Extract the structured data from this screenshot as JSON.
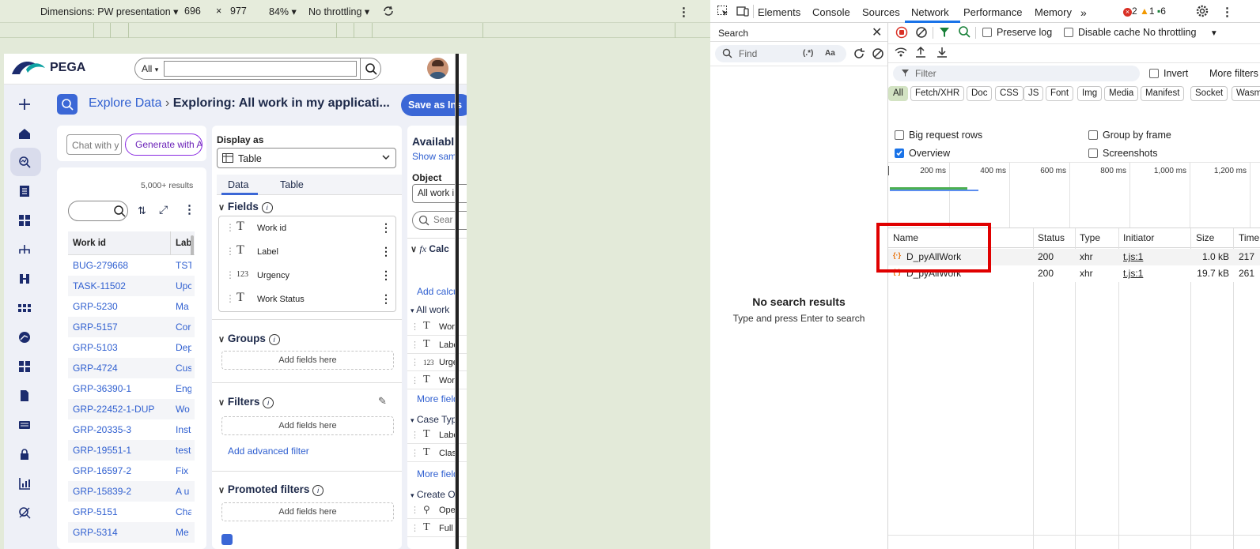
{
  "device_toolbar": {
    "dimensions_label": "Dimensions: PW presentation",
    "width": "696",
    "times": "×",
    "height": "977",
    "zoom": "84%",
    "throttling": "No throttling"
  },
  "pega": {
    "logo": "PEGA",
    "search_scope": "All",
    "search_placeholder": "",
    "breadcrumb_parent": "Explore Data",
    "breadcrumb_sep": "›",
    "breadcrumb_current": "Exploring: All work in my applicati...",
    "save_button": "Save as Ins",
    "chat_placeholder": "Chat with y",
    "generate_button": "Generate with AI",
    "results_count": "5,000+ results",
    "columns": [
      "Work id",
      "Lab"
    ],
    "rows": [
      {
        "id": "BUG-279668",
        "label": "TST"
      },
      {
        "id": "TASK-11502",
        "label": "Upc"
      },
      {
        "id": "GRP-5230",
        "label": "Ma"
      },
      {
        "id": "GRP-5157",
        "label": "Cor"
      },
      {
        "id": "GRP-5103",
        "label": "Dep"
      },
      {
        "id": "GRP-4724",
        "label": "Cus"
      },
      {
        "id": "GRP-36390-1",
        "label": "Eng"
      },
      {
        "id": "GRP-22452-1-DUP",
        "label": "Wo"
      },
      {
        "id": "GRP-20335-3",
        "label": "Inst"
      },
      {
        "id": "GRP-19551-1",
        "label": "test"
      },
      {
        "id": "GRP-16597-2",
        "label": "Fix"
      },
      {
        "id": "GRP-15839-2",
        "label": "A u"
      },
      {
        "id": "GRP-5151",
        "label": "Cha"
      },
      {
        "id": "GRP-5314",
        "label": "Me"
      }
    ],
    "display_as_label": "Display as",
    "display_as_value": "Table",
    "tabs": [
      "Data",
      "Table"
    ],
    "fields_title": "Fields",
    "fields": [
      {
        "type": "T",
        "name": "Work id"
      },
      {
        "type": "T",
        "name": "Label"
      },
      {
        "type": "123",
        "name": "Urgency"
      },
      {
        "type": "T",
        "name": "Work Status"
      }
    ],
    "groups_title": "Groups",
    "filters_title": "Filters",
    "promoted_title": "Promoted filters",
    "add_fields_here": "Add fields here",
    "add_advanced_filter": "Add advanced filter",
    "available_title": "Availabl",
    "show_sample": "Show sam",
    "object_label": "Object",
    "object_value": "All work i",
    "avail_search": "Sear",
    "calc_title": "Calc",
    "add_calc": "Add calcu",
    "all_work_group": "All work",
    "all_work_items": [
      {
        "type": "T",
        "name": "Wor"
      },
      {
        "type": "T",
        "name": "Labe"
      },
      {
        "type": "123",
        "name": "Urge"
      },
      {
        "type": "T",
        "name": "Wor"
      }
    ],
    "more_fields": "More field",
    "case_type_group": "Case Typ",
    "case_type_items": [
      {
        "type": "T",
        "name": "Labe"
      },
      {
        "type": "T",
        "name": "Clas"
      }
    ],
    "create_group": "Create O",
    "create_items": [
      {
        "type": "person",
        "name": "Ope"
      },
      {
        "type": "T",
        "name": "Full"
      }
    ]
  },
  "devtools": {
    "tabs": [
      "Elements",
      "Console",
      "Sources",
      "Network",
      "Performance",
      "Memory"
    ],
    "active_tab": "Network",
    "errors": "2",
    "warnings": "1",
    "messages": "6",
    "search_title": "Search",
    "find_placeholder": "Find",
    "regex_label": "(.*)",
    "case_label": "Aa",
    "no_results": "No search results",
    "no_results_hint": "Type and press Enter to search",
    "preserve_log": "Preserve log",
    "disable_cache": "Disable cache",
    "throttling": "No throttling",
    "filter_placeholder": "Filter",
    "invert": "Invert",
    "more_filters": "More filters",
    "type_filters": [
      "All",
      "Fetch/XHR",
      "Doc",
      "CSS",
      "JS",
      "Font",
      "Img",
      "Media",
      "Manifest",
      "Socket",
      "Wasm"
    ],
    "big_request_rows": "Big request rows",
    "group_by_frame": "Group by frame",
    "overview": "Overview",
    "screenshots": "Screenshots",
    "timeline_ticks": [
      "200 ms",
      "400 ms",
      "600 ms",
      "800 ms",
      "1,000 ms",
      "1,200 ms"
    ],
    "columns": [
      "Name",
      "Status",
      "Type",
      "Initiator",
      "Size",
      "Time"
    ],
    "requests": [
      {
        "name": "D_pyAllWork",
        "status": "200",
        "type": "xhr",
        "initiator": "t.js:1",
        "size": "1.0 kB",
        "time": "217"
      },
      {
        "name": "D_pyAllWork",
        "status": "200",
        "type": "xhr",
        "initiator": "t.js:1",
        "size": "19.7 kB",
        "time": "261"
      }
    ],
    "highlight_color": "#e00000"
  }
}
